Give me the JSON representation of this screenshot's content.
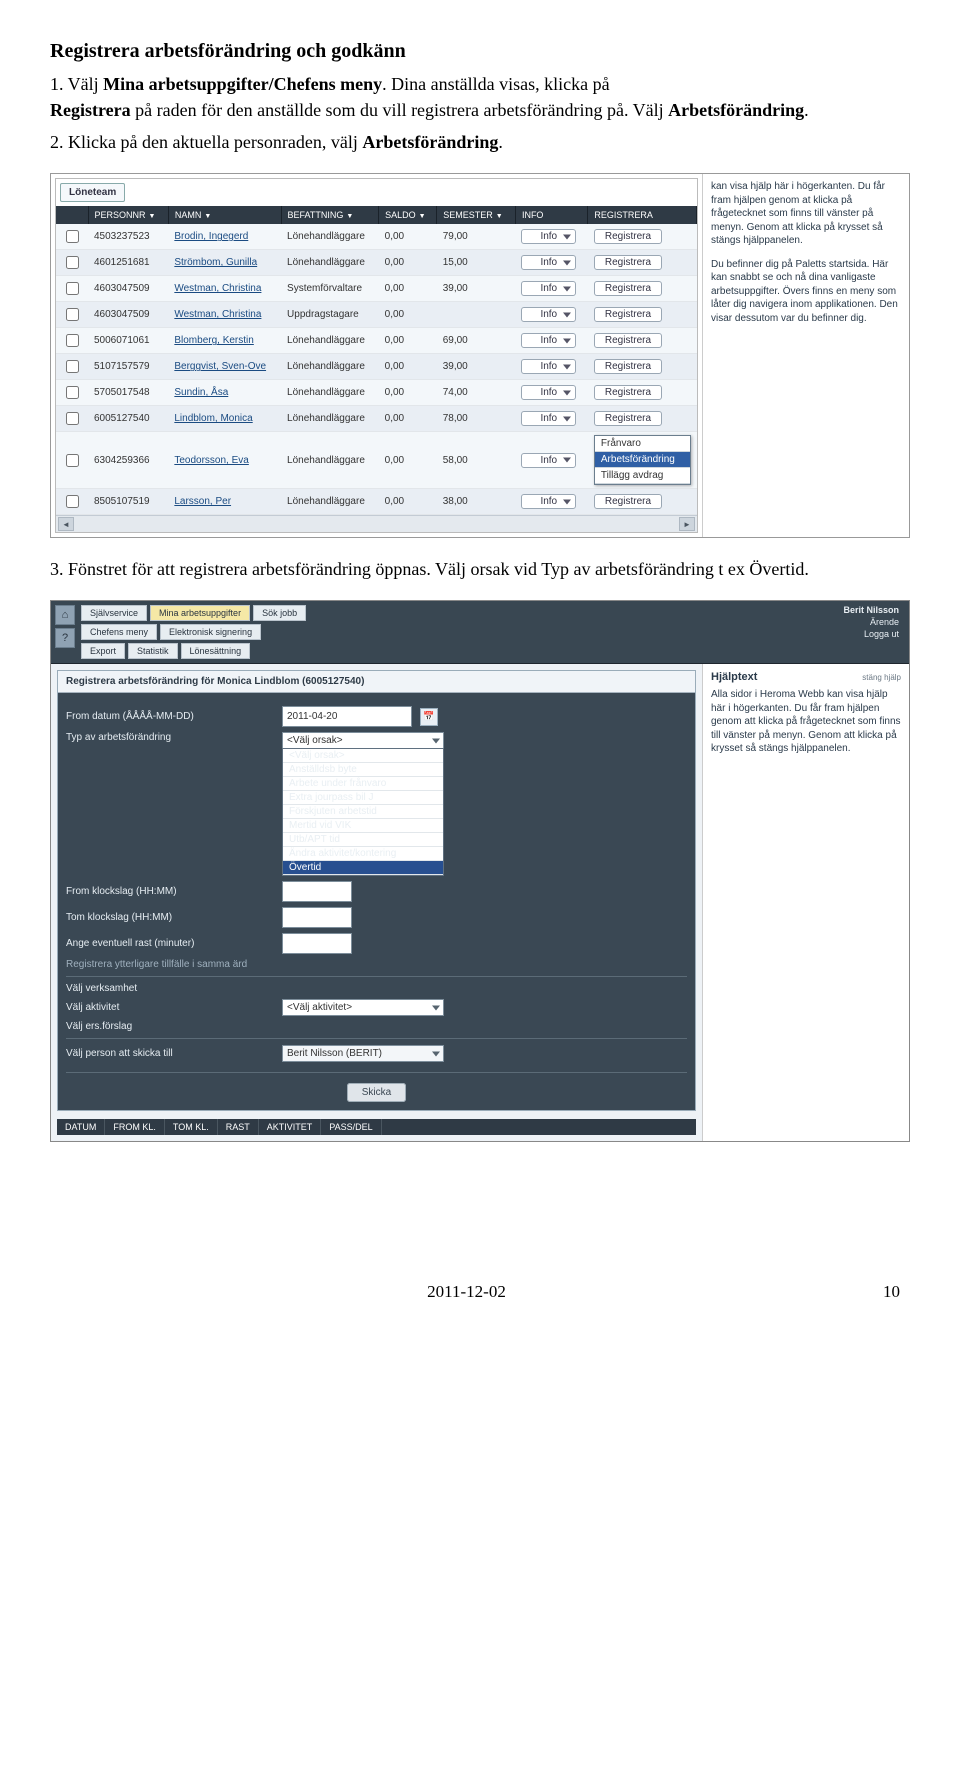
{
  "doc": {
    "title": "Registrera arbetsförändring och godkänn",
    "p1a": "1. Välj ",
    "p1b": "Mina arbetsuppgifter/Chefens meny",
    "p1c": ". Dina anställda visas, klicka på",
    "line2a": "Registrera",
    "line2b": " på raden för den anställde som du vill registrera arbetsförändring på. Välj ",
    "line2c": "Arbetsförändring",
    "line2d": ".",
    "p2a": "2. Klicka på den aktuella personraden, välj ",
    "p2b": "Arbetsförändring",
    "p2c": ".",
    "p3a": "3. Fönstret för att registrera arbetsförändring öppnas. Välj orsak vid Typ av arbetsförändring t ex Övertid.",
    "footer_date": "2011-12-02",
    "footer_page": "10"
  },
  "scr1": {
    "panel": "Löneteam",
    "columns": [
      "PERSONNR",
      "NAMN",
      "BEFATTNING",
      "SALDO",
      "SEMESTER",
      "INFO",
      "REGISTRERA"
    ],
    "info_label": "Info",
    "reg_label": "Registrera",
    "rows": [
      {
        "pn": "4503237523",
        "namn": "Brodin, Ingegerd",
        "bef": "Lönehandläggare",
        "saldo": "0,00",
        "sem": "79,00",
        "open": false
      },
      {
        "pn": "4601251681",
        "namn": "Strömbom, Gunilla",
        "bef": "Lönehandläggare",
        "saldo": "0,00",
        "sem": "15,00",
        "open": false
      },
      {
        "pn": "4603047509",
        "namn": "Westman, Christina",
        "bef": "Systemförvaltare",
        "saldo": "0,00",
        "sem": "39,00",
        "open": false
      },
      {
        "pn": "4603047509",
        "namn": "Westman, Christina",
        "bef": "Uppdragstagare",
        "saldo": "0,00",
        "sem": "",
        "open": false
      },
      {
        "pn": "5006071061",
        "namn": "Blomberg, Kerstin",
        "bef": "Lönehandläggare",
        "saldo": "0,00",
        "sem": "69,00",
        "open": false
      },
      {
        "pn": "5107157579",
        "namn": "Berggvist, Sven-Ove",
        "bef": "Lönehandläggare",
        "saldo": "0,00",
        "sem": "39,00",
        "open": false
      },
      {
        "pn": "5705017548",
        "namn": "Sundin, Åsa",
        "bef": "Lönehandläggare",
        "saldo": "0,00",
        "sem": "74,00",
        "open": false
      },
      {
        "pn": "6005127540",
        "namn": "Lindblom, Monica",
        "bef": "Lönehandläggare",
        "saldo": "0,00",
        "sem": "78,00",
        "open": false
      },
      {
        "pn": "6304259366",
        "namn": "Teodorsson, Eva",
        "bef": "Lönehandläggare",
        "saldo": "0,00",
        "sem": "58,00",
        "open": true
      },
      {
        "pn": "8505107519",
        "namn": "Larsson, Per",
        "bef": "Lönehandläggare",
        "saldo": "0,00",
        "sem": "38,00",
        "open": false
      }
    ],
    "submenu": [
      "Frånvaro",
      "Arbetsförändring",
      "Tillägg avdrag"
    ],
    "help": "kan visa hjälp här i högerkanten. Du får fram hjälpen genom at klicka på frågetecknet som finns till vänster på menyn. Genom att klicka på krysset så stängs hjälppanelen.\n\nDu befinner dig på Paletts startsida. Här kan snabbt se och nå dina vanligaste arbetsuppgifter. Övers finns en meny som låter dig navigera inom applikationen. Den visar dessutom var du befinner dig."
  },
  "scr2": {
    "tabs_row1": [
      "Självservice",
      "Mina arbetsuppgifter",
      "Sök jobb"
    ],
    "tabs_row2": [
      "Chefens meny",
      "Elektronisk signering"
    ],
    "tabs_row3": [
      "Export",
      "Statistik",
      "Lönesättning"
    ],
    "user_name": "Berit Nilsson",
    "user_link1": "Ärende",
    "user_link2": "Logga ut",
    "form_title": "Registrera arbetsförändring för Monica Lindblom (6005127540)",
    "labels": {
      "from_datum": "From datum (ÅÅÅÅ-MM-DD)",
      "typ": "Typ av arbetsförändring",
      "from_kl": "From klockslag (HH:MM)",
      "tom_kl": "Tom klockslag (HH:MM)",
      "rast": "Ange eventuell rast (minuter)",
      "ytter": "Registrera ytterligare tillfälle i samma ärd",
      "verksamhet": "Välj verksamhet",
      "aktivitet": "Välj aktivitet",
      "ers": "Välj ers.förslag",
      "person": "Välj person att skicka till"
    },
    "values": {
      "from_datum": "2011-04-20",
      "typ_sel": "<Välj orsak>",
      "aktivitet_sel": "<Välj aktivitet>",
      "person_val": "Berit Nilsson (BERIT)"
    },
    "orsak_options": [
      "<Välj orsak>",
      "Anställdsb byte",
      "Arbete under frånvaro",
      "Extra jourpass bil J",
      "Förskjuten arbetstid",
      "Mertid vid VIK",
      "Utb/APT tid",
      "Ändra aktivitet/kontering",
      "Övertid"
    ],
    "skicka": "Skicka",
    "header_cols": [
      "DATUM",
      "FROM KL.",
      "TOM KL.",
      "RAST",
      "AKTIVITET",
      "PASS/DEL"
    ],
    "help_title": "Hjälptext",
    "help_close": "stäng hjälp",
    "help_body": "Alla sidor i Heroma Webb kan visa hjälp här i högerkanten. Du får fram hjälpen genom att klicka på frågetecknet som finns till vänster på menyn. Genom att klicka på krysset så stängs hjälppanelen."
  }
}
